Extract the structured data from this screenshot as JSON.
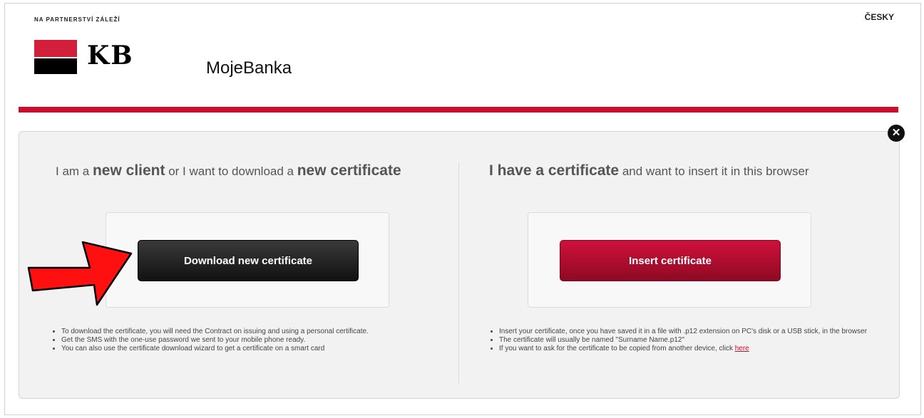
{
  "header": {
    "tagline": "NA PARTNERSTVÍ ZÁLEŽÍ",
    "language_link": "ČESKY",
    "logo_text": "KB",
    "app_name": "MojeBanka"
  },
  "colors": {
    "brand_red": "#c8102e",
    "dark_button": "#1a1a1a"
  },
  "icons": {
    "close": "close-icon",
    "arrow": "red-arrow-icon"
  },
  "new_client": {
    "heading_1": "I am a ",
    "heading_2": "new client",
    "heading_3": " or I want to download a ",
    "heading_4": "new certificate",
    "button_label": "Download new certificate",
    "notes": [
      "To download the certificate, you will need the Contract on issuing and using a personal certificate.",
      "Get the SMS with the one-use password we sent to your mobile phone ready.",
      "You can also use the certificate download wizard to get a certificate on a smart card"
    ]
  },
  "existing_client": {
    "heading_1": "I have a certificate",
    "heading_2": " and want to insert it in this browser",
    "button_label": "Insert certificate",
    "notes": [
      "Insert your certificate, once you have saved it in a file with .p12 extension on PC's disk or a USB stick, in the browser",
      "The certificate will usually be named \"Surname Name.p12\""
    ],
    "note_last_prefix": "If you want to ask for the certificate to be copied from another device, click ",
    "note_last_link": "here"
  }
}
